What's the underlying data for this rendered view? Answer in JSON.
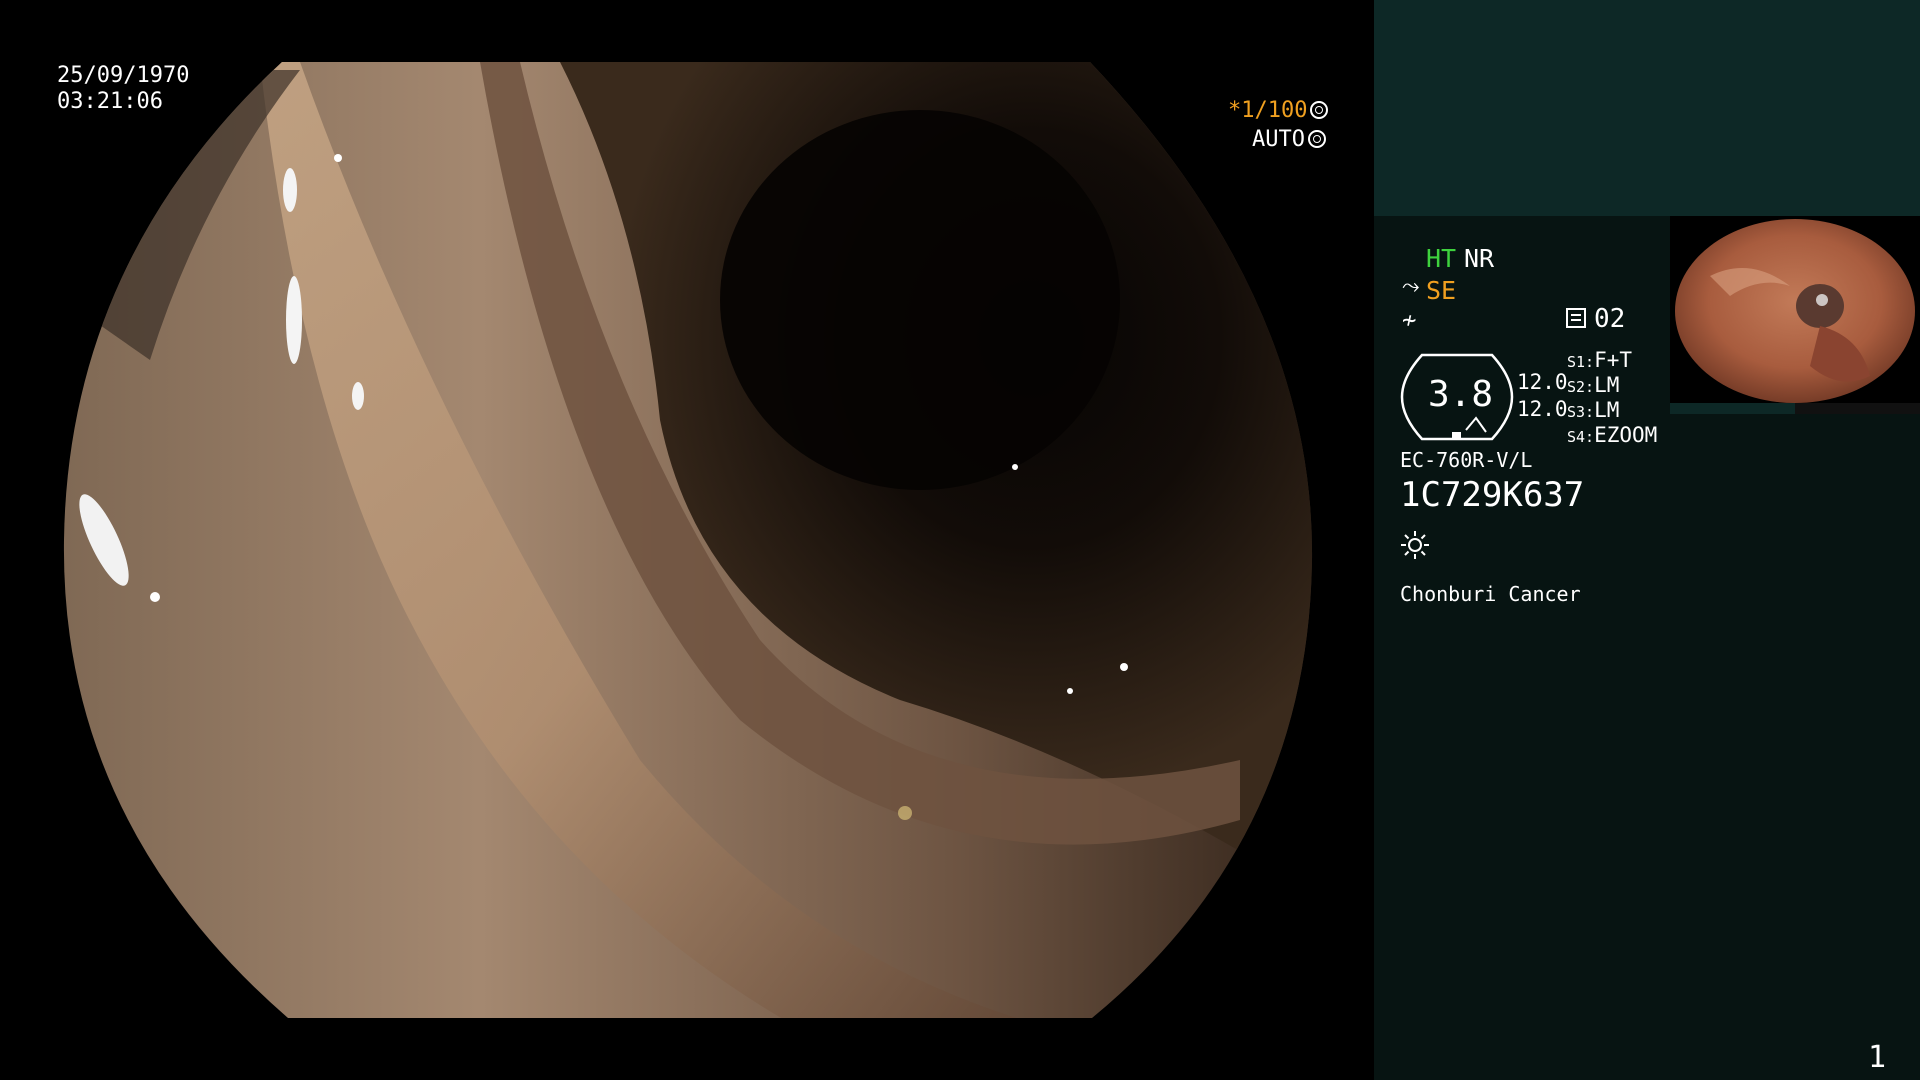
{
  "scope_view": {
    "date": "25/09/1970",
    "time": "03:21:06",
    "shutter": "*1/100",
    "iris_mode": "AUTO"
  },
  "panel": {
    "ht": "HT",
    "nr": "NR",
    "se": "SE",
    "memory_value": "02",
    "gauge_value": "3.8",
    "value_a": "12.0",
    "value_b": "12.0",
    "switches": [
      {
        "key": "S1:",
        "value": "F+T"
      },
      {
        "key": "S2:",
        "value": "LM"
      },
      {
        "key": "S3:",
        "value": "LM"
      },
      {
        "key": "S4:",
        "value": "EZOOM"
      }
    ],
    "scope_model": "EC-760R-V/L",
    "serial": "1C729K637",
    "hospital": "Chonburi Cancer",
    "page_number": "1"
  },
  "icons": {
    "shutter_icon": "aperture-icon",
    "iris_icon": "iris-icon",
    "se_icon": "hook-icon",
    "fx_icon": "function-icon",
    "memory_icon": "memory-card-icon",
    "light_icon": "sun-icon"
  },
  "colors": {
    "panel_bg": "#071412",
    "panel_header": "#0d2826",
    "ht_color": "#3ed23e",
    "se_color": "#f0a020",
    "shutter_color": "#f0a020"
  }
}
